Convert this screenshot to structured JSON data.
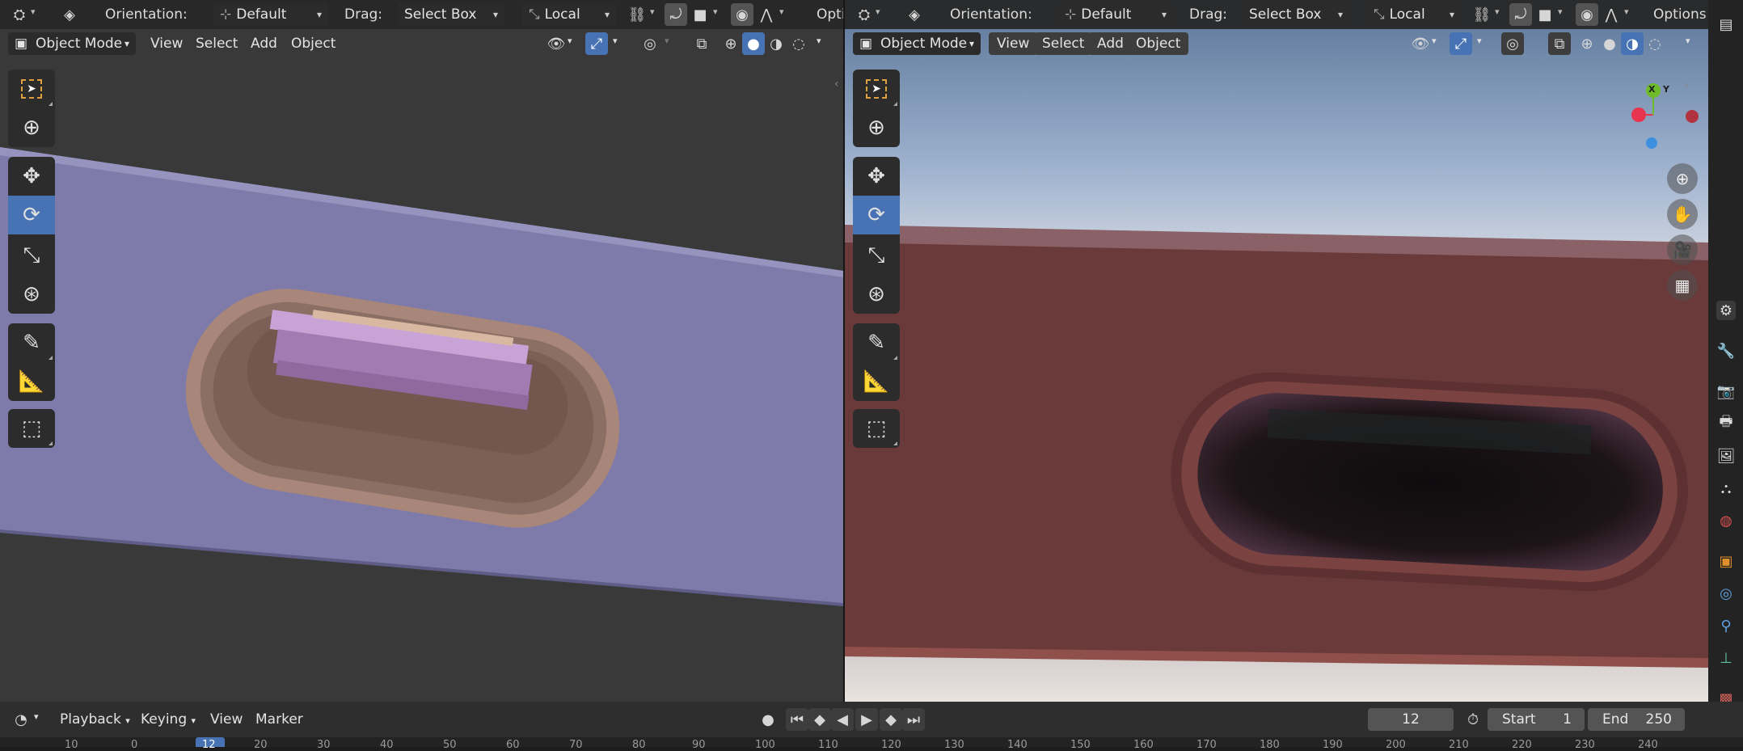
{
  "header": {
    "orientation_label": "Orientation:",
    "orientation_value": "Default",
    "drag_label": "Drag:",
    "drag_value": "Select Box",
    "pivot_value": "Local",
    "options_label_left": "Opti",
    "options_label_right": "Options"
  },
  "viewport_menu": {
    "mode": "Object Mode",
    "items": [
      "View",
      "Select",
      "Add",
      "Object"
    ]
  },
  "gizmo": {
    "x": "X",
    "y": "Y"
  },
  "timeline": {
    "playback": "Playback",
    "keying": "Keying",
    "view": "View",
    "marker": "Marker",
    "current_frame": "12",
    "start_label": "Start",
    "start_value": "1",
    "end_label": "End",
    "end_value": "250",
    "ruler_ticks": [
      "10",
      "0",
      "12",
      "20",
      "30",
      "40",
      "50",
      "60",
      "70",
      "80",
      "90",
      "100",
      "110",
      "120",
      "130",
      "140",
      "150",
      "160",
      "170",
      "180",
      "190",
      "200",
      "210",
      "220",
      "230",
      "240"
    ]
  },
  "colors": {
    "accent": "#4772b3",
    "left_body": "#7d79a8",
    "left_bezel": "#a8877a",
    "left_insert": "#a87fb5",
    "right_body": "#6a3a3a",
    "axis_x": "#e8344e",
    "axis_y": "#6dbb2a",
    "axis_z": "#3d8fe0"
  }
}
